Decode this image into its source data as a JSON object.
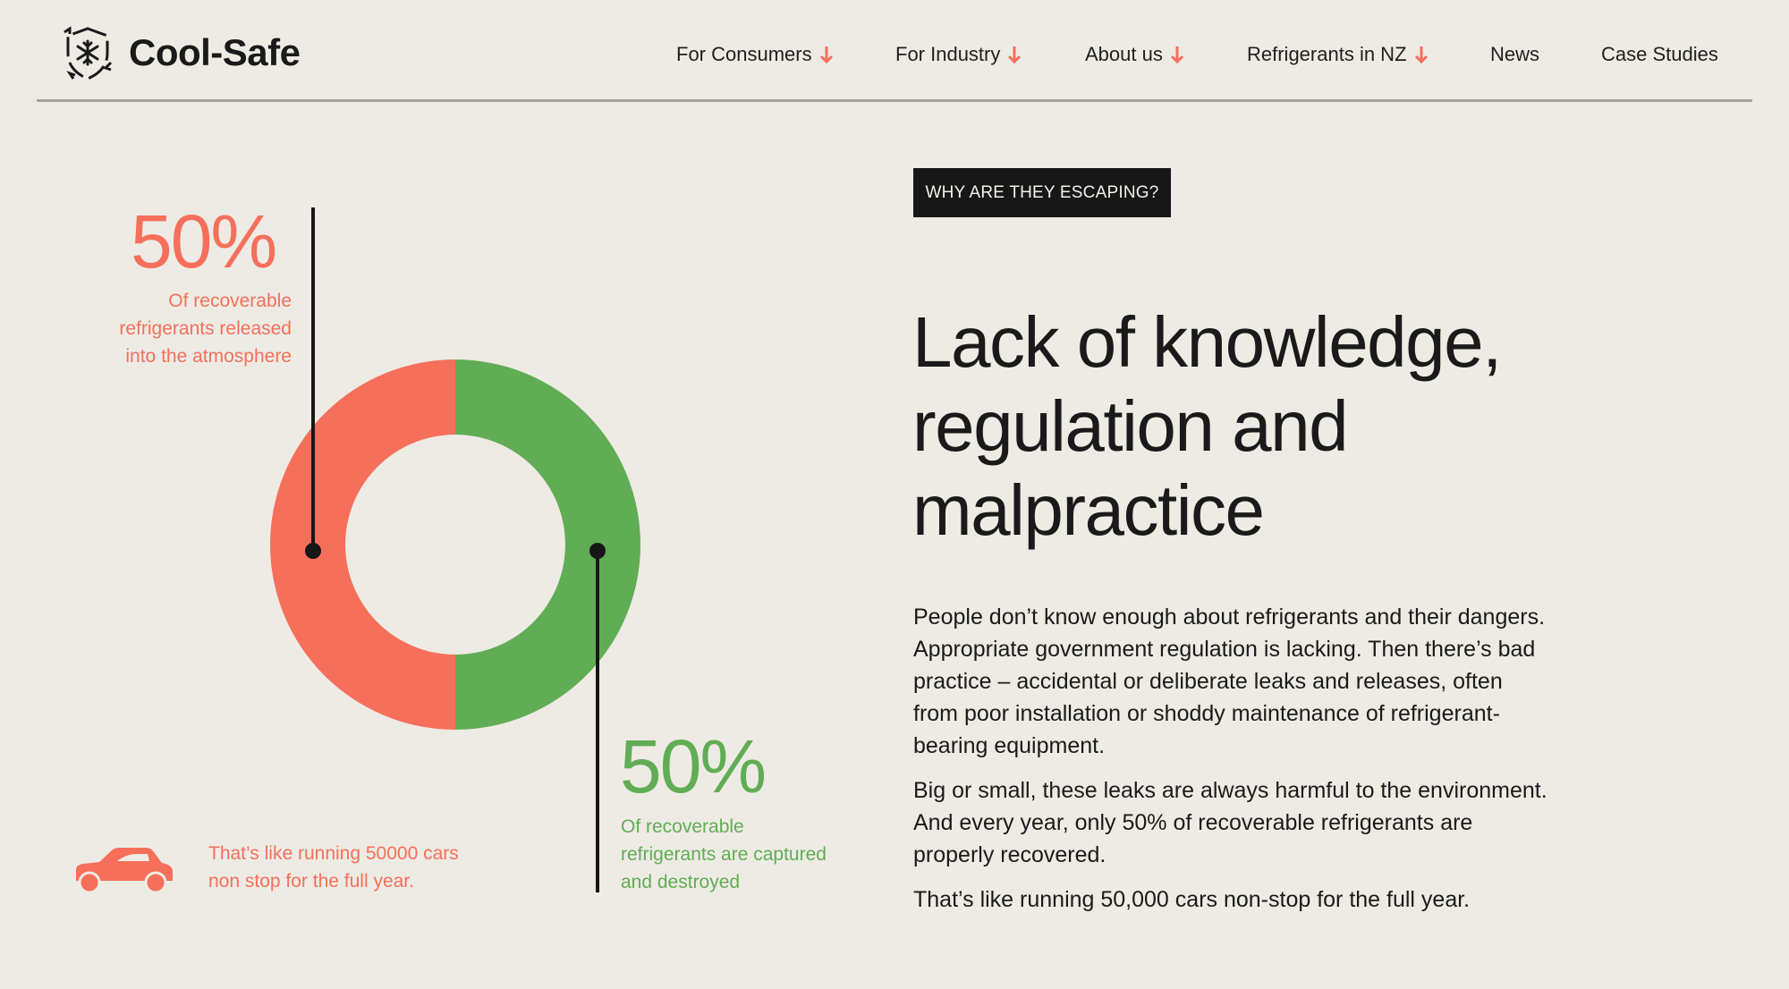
{
  "brand": {
    "name": "Cool-Safe",
    "logo_icon": "snowflake-shield-icon"
  },
  "nav": [
    {
      "label": "For Consumers",
      "has_dropdown": true
    },
    {
      "label": "For Industry",
      "has_dropdown": true
    },
    {
      "label": "About us",
      "has_dropdown": true
    },
    {
      "label": "Refrigerants in NZ",
      "has_dropdown": true
    },
    {
      "label": "News",
      "has_dropdown": false
    },
    {
      "label": "Case Studies",
      "has_dropdown": false
    }
  ],
  "colors": {
    "accent_red": "#f66f5b",
    "accent_green": "#61ad55",
    "background": "#edebe4",
    "dark": "#171717"
  },
  "chart": {
    "released": {
      "percent": "50%",
      "caption": [
        "Of recoverable",
        "refrigerants released",
        "into the atmosphere"
      ]
    },
    "captured": {
      "percent": "50%",
      "caption": [
        "Of recoverable",
        "refrigerants are captured",
        "and destroyed"
      ]
    },
    "car_note": {
      "icon": "car-icon",
      "lines": [
        "That’s like running 50000 cars",
        "non stop for the full year."
      ]
    }
  },
  "chart_data": {
    "type": "pie",
    "variant": "donut",
    "categories": [
      "Released into the atmosphere",
      "Captured and destroyed"
    ],
    "values": [
      50,
      50
    ],
    "colors": [
      "#f66f5b",
      "#61ad55"
    ]
  },
  "content": {
    "tag": "WHY ARE THEY ESCAPING?",
    "headline": [
      "Lack of knowledge,",
      "regulation and",
      "malpractice"
    ],
    "p1": [
      "People don’t know enough about refrigerants and their dangers.",
      "Appropriate government regulation is lacking. Then there’s bad",
      "practice – accidental or deliberate leaks and releases, often",
      "from poor installation or shoddy maintenance of refrigerant-",
      "bearing equipment."
    ],
    "p2": [
      "Big or small, these leaks are always harmful to the environment.",
      "And every year, only 50% of recoverable refrigerants are",
      "properly recovered."
    ],
    "p3": "That’s like running 50,000 cars non-stop for the full year."
  }
}
